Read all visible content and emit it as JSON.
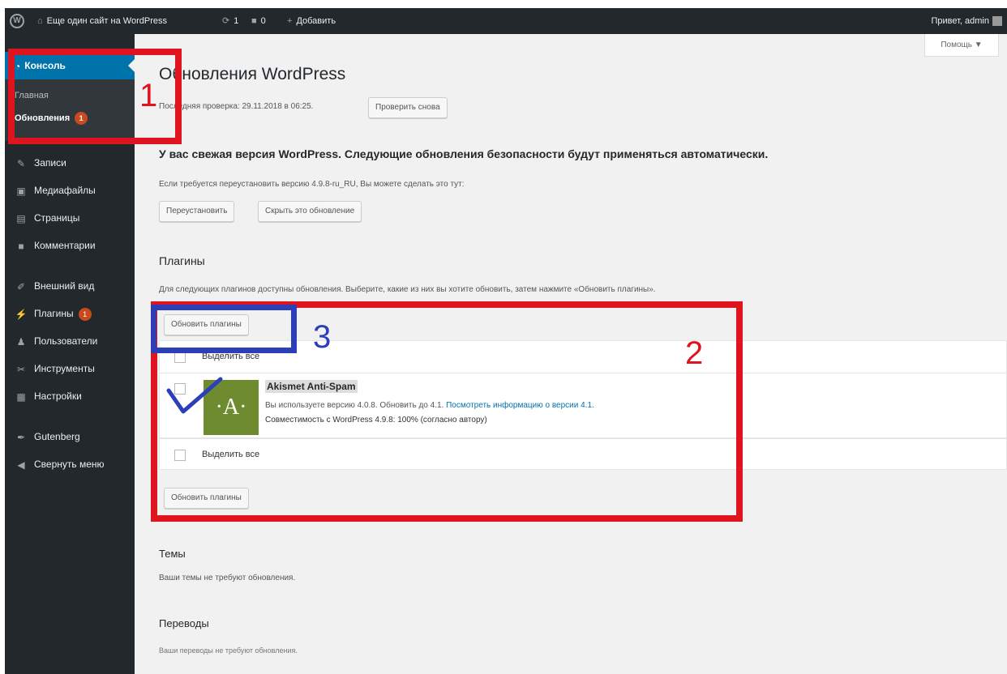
{
  "admin_bar": {
    "site_name": "Еще один сайт на WordPress",
    "updates_count": "1",
    "comments_count": "0",
    "add_new": "Добавить",
    "greeting": "Привет, admin"
  },
  "sidebar": {
    "current": "Консоль",
    "submenu": {
      "home": "Главная",
      "updates": "Обновления",
      "updates_count": "1"
    },
    "items": [
      {
        "label": "Записи",
        "icon": "pin-icon"
      },
      {
        "label": "Медиафайлы",
        "icon": "media-icon"
      },
      {
        "label": "Страницы",
        "icon": "page-icon"
      },
      {
        "label": "Комментарии",
        "icon": "comment-icon"
      },
      {
        "label": "Внешний вид",
        "icon": "brush-icon"
      },
      {
        "label": "Плагины",
        "icon": "plugin-icon",
        "count": "1"
      },
      {
        "label": "Пользователи",
        "icon": "users-icon"
      },
      {
        "label": "Инструменты",
        "icon": "tools-icon"
      },
      {
        "label": "Настройки",
        "icon": "settings-icon"
      },
      {
        "label": "Gutenberg",
        "icon": "pen-icon"
      },
      {
        "label": "Свернуть меню",
        "icon": "collapse-icon"
      }
    ]
  },
  "help_tab": "Помощь ▼",
  "main": {
    "title": "Обновления WordPress",
    "last_check": "Последняя проверка: 29.11.2018 в 06:25.",
    "check_again": "Проверить снова",
    "latest_message": "У вас свежая версия WordPress. Следующие обновления безопасности будут применяться автоматически.",
    "reinstall_text": "Если требуется переустановить версию 4.9.8-ru_RU, Вы можете сделать это тут:",
    "reinstall_button": "Переустановить",
    "hide_button": "Скрыть это обновление",
    "plugins_heading": "Плагины",
    "plugins_desc": "Для следующих плагинов доступны обновления. Выберите, какие из них вы хотите обновить, затем нажмите «Обновить плагины».",
    "update_plugins_button": "Обновить плагины",
    "select_all": "Выделить все",
    "plugin": {
      "name": "Akismet Anti-Spam",
      "logo_letter": "·A·",
      "version_text": "Вы используете версию 4.0.8. Обновить до 4.1.",
      "details_link": "Посмотреть информацию о версии 4.1.",
      "compat": "Совместимость с WordPress 4.9.8: 100% (согласно автору)"
    },
    "themes_heading": "Темы",
    "themes_desc": "Ваши темы не требуют обновления.",
    "translations_heading": "Переводы",
    "translations_desc": "Ваши переводы не требуют обновления."
  },
  "annotations": {
    "one": "1",
    "two": "2",
    "three": "3"
  },
  "colors": {
    "accent": "#0073aa",
    "annotation_red": "#e0141e",
    "annotation_blue": "#2c3fb8",
    "sidebar_bg": "#23282d"
  }
}
